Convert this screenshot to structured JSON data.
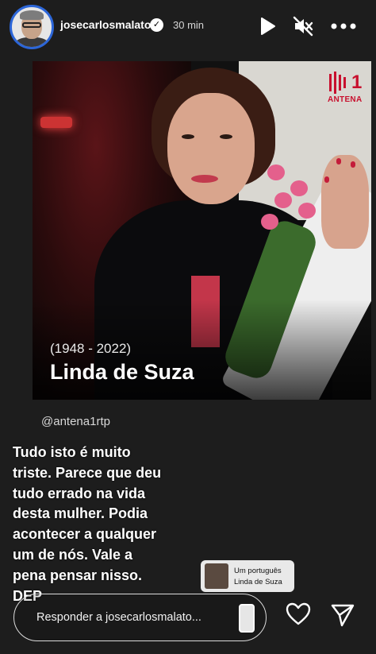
{
  "header": {
    "username": "josecarlosmalato",
    "time": "30 min",
    "icons": [
      "play-icon",
      "mute-icon",
      "more-icon",
      "verified-badge-icon"
    ]
  },
  "post": {
    "logo_number": "1",
    "logo_brand": "ANTENA",
    "years": "(1948 - 2022)",
    "name": "Linda de Suza",
    "handle": "@antena1rtp"
  },
  "caption": "Tudo isto é muito\ntriste. Parece que deu\ntudo errado na vida\ndesta mulher. Podia\nacontecer a qualquer\num de nós. Vale a\npena pensar nisso.\nDEP",
  "music": {
    "artist": "Um português",
    "title": "Linda de Suza"
  },
  "reply": {
    "placeholder": "Responder a josecarlosmalato..."
  },
  "colors": {
    "background": "#1d1d1d",
    "brand_red": "#c8102e",
    "avatar_ring": "#2c66d8"
  }
}
